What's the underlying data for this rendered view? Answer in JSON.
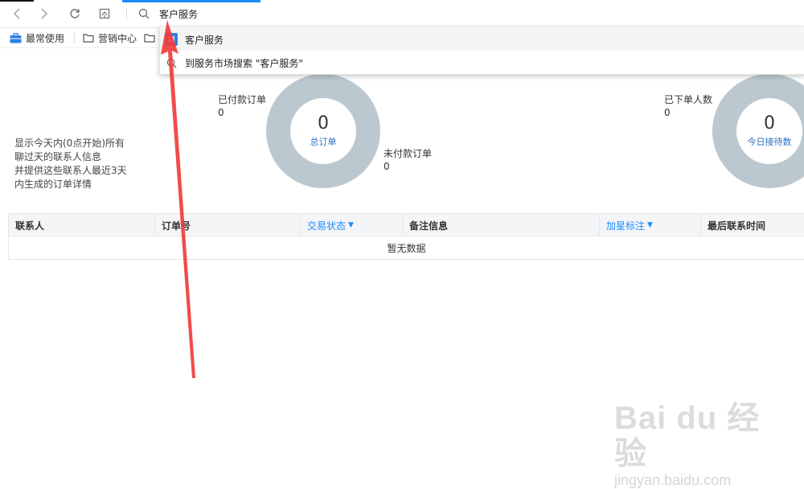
{
  "browser": {
    "address_value": "客户服务",
    "bookmarks": [
      {
        "label": "最常使用",
        "icon": "briefcase-icon"
      },
      {
        "label": "营销中心",
        "icon": "folder-icon"
      },
      {
        "label": "",
        "icon": "folder-icon"
      }
    ]
  },
  "suggestions": [
    {
      "label": "客户服务",
      "icon": "app-icon"
    },
    {
      "label": "到服务市场搜索 \"客户服务\"",
      "icon": "search-icon"
    }
  ],
  "description": {
    "lines": [
      "显示今天内(0点开始)所有",
      "聊过天的联系人信息",
      "并提供这些联系人最近3天",
      "内生成的订单详情"
    ]
  },
  "stats": {
    "paid_label": "已付款订单",
    "paid_value": "0",
    "unpaid_label": "未付款订单",
    "unpaid_value": "0",
    "total_value": "0",
    "total_caption": "总订单",
    "buyers_label": "已下单人数",
    "buyers_value": "0",
    "reception_value": "0",
    "reception_caption": "今日接待数"
  },
  "table": {
    "headers": [
      "联系人",
      "订单号",
      "交易状态",
      "备注信息",
      "加星标注",
      "最后联系时间"
    ],
    "empty_text": "暂无数据"
  },
  "watermark": {
    "main": "Bai du 经验",
    "sub": "jingyan.baidu.com"
  },
  "colors": {
    "accent": "#1a8cff",
    "donut": "#bcc8d0",
    "arrow": "#f03c3c"
  }
}
